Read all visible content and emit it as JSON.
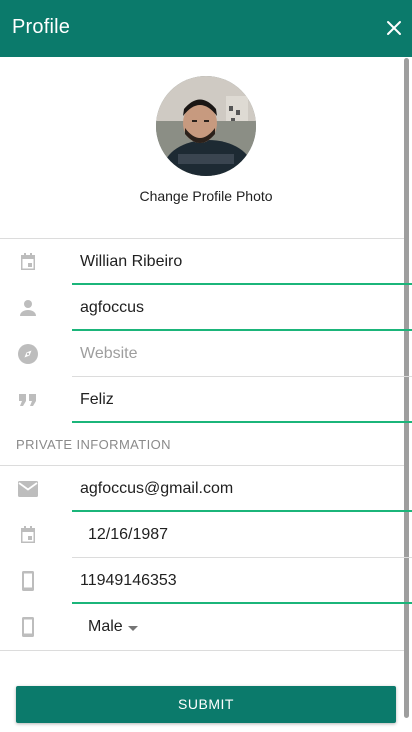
{
  "appbar": {
    "title": "Profile",
    "close_icon": "close-icon",
    "color": "#0b7a6b"
  },
  "profile": {
    "change_photo_label": "Change Profile Photo"
  },
  "fields": {
    "name": {
      "icon": "calendar-icon",
      "value": "Willian Ribeiro"
    },
    "username": {
      "icon": "person-icon",
      "value": "agfoccus"
    },
    "website": {
      "icon": "compass-icon",
      "placeholder": "Website"
    },
    "bio": {
      "icon": "quote-icon",
      "value": "Feliz"
    }
  },
  "private": {
    "section_label": "PRIVATE INFORMATION",
    "email": {
      "icon": "email-icon",
      "value": "agfoccus@gmail.com"
    },
    "birthday": {
      "icon": "calendar-icon",
      "value": "12/16/1987"
    },
    "phone": {
      "icon": "phone-icon",
      "value": "11949146353"
    },
    "gender": {
      "icon": "phone-icon",
      "value": "Male"
    }
  },
  "submit_label": "SUBMIT",
  "accent_color": "#1bb57a"
}
